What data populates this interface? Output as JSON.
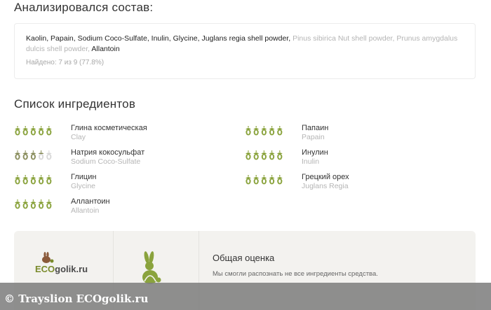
{
  "analyzed": {
    "title": "Анализировался состав:",
    "ingredients": [
      {
        "text": "Kaolin",
        "found": true
      },
      {
        "text": "Papain",
        "found": true
      },
      {
        "text": "Sodium Coco-Sulfate",
        "found": true
      },
      {
        "text": "Inulin",
        "found": true
      },
      {
        "text": "Glycine",
        "found": true
      },
      {
        "text": "Juglans regia shell powder",
        "found": true
      },
      {
        "text": "Pinus sibirica Nut shell powder",
        "found": false
      },
      {
        "text": "Prunus amygdalus dulcis shell powder",
        "found": false
      },
      {
        "text": "Allantoin",
        "found": true
      }
    ],
    "found_text": "Найдено: 7 из 9 (77.8%)"
  },
  "list": {
    "title": "Список ингредиентов",
    "items": [
      {
        "ru": "Глина косметическая",
        "en": "Clay",
        "rating": 5
      },
      {
        "ru": "Папаин",
        "en": "Papain",
        "rating": 5
      },
      {
        "ru": "Натрия кокосульфат",
        "en": "Sodium Coco-Sulfate",
        "rating": 3.5
      },
      {
        "ru": "Инулин",
        "en": "Inulin",
        "rating": 5
      },
      {
        "ru": "Глицин",
        "en": "Glycine",
        "rating": 5
      },
      {
        "ru": "Грецкий орех",
        "en": "Juglans Regia",
        "rating": 5
      },
      {
        "ru": "Аллантоин",
        "en": "Allantoin",
        "rating": 5
      }
    ]
  },
  "summary": {
    "logo_eco": "ECO",
    "logo_rest": "golik.ru",
    "overall_title": "Общая оценка",
    "overall_desc": "Мы смогли распознать не все ингредиенты средства."
  },
  "watermark": {
    "text": "© Trayslion ECOgolik.ru"
  },
  "colors": {
    "rating_green": "#8aa33d",
    "rating_dark": "#8b8f5f",
    "rating_empty": "#d9d9d9",
    "logo_green": "#7a8b2c",
    "rabbit_green": "#8aa33d"
  },
  "icons": {
    "rating": "acorn-icon",
    "logo": "eco-logo-rabbit-icon",
    "rabbit": "rabbit-icon"
  }
}
